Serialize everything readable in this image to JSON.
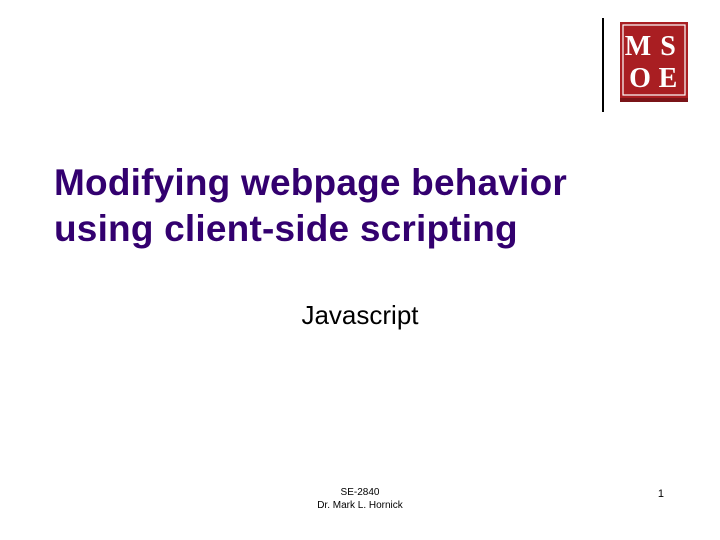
{
  "title": "Modifying webpage behavior using client-side scripting",
  "subtitle": "Javascript",
  "footer": {
    "course": "SE-2840",
    "instructor": "Dr. Mark L. Hornick"
  },
  "page_number": "1",
  "logo": {
    "letters": [
      "M",
      "S",
      "O",
      "E"
    ],
    "bg": "#a91e22",
    "fg": "#ffffff"
  }
}
